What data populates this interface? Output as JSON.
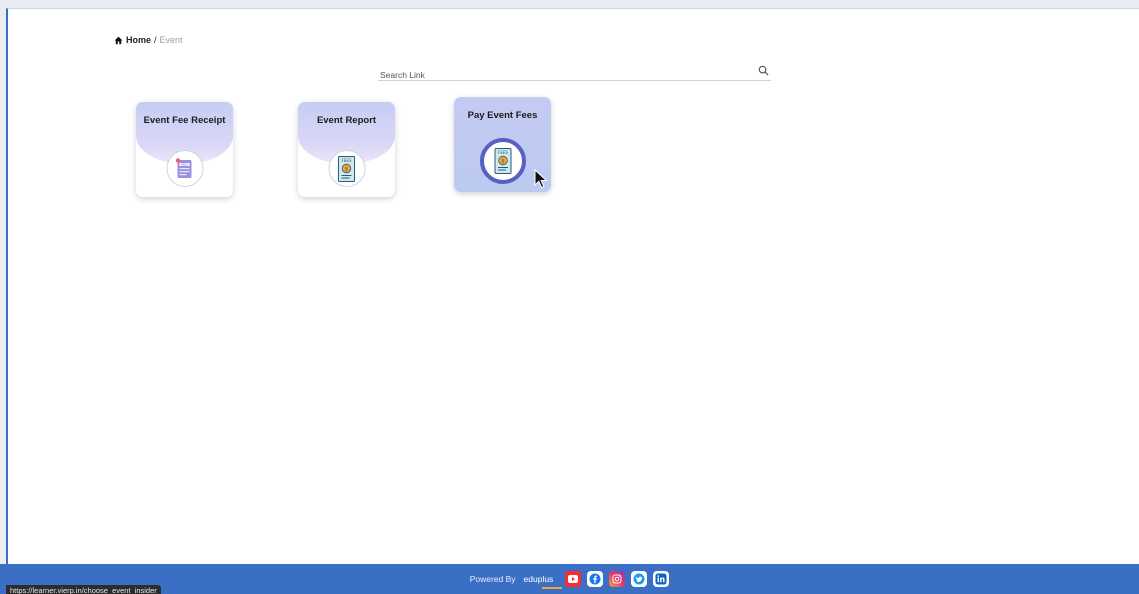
{
  "breadcrumb": {
    "home": "Home",
    "separator": "/",
    "current": "Event"
  },
  "search": {
    "placeholder": "Search Link",
    "value": ""
  },
  "cards": [
    {
      "title": "Event Fee Receipt",
      "icon": "fees-receipt-icon"
    },
    {
      "title": "Event Report",
      "icon": "fees-report-icon"
    },
    {
      "title": "Pay Event Fees",
      "icon": "pay-fees-icon",
      "active": true
    }
  ],
  "footer": {
    "powered_by": "Powered By",
    "brand": "eduplus",
    "social": [
      "youtube-icon",
      "facebook-icon",
      "instagram-icon",
      "twitter-icon",
      "linkedin-icon"
    ]
  },
  "status_bar": {
    "url": "https://learner.vierp.in/choose_event_insider"
  },
  "colors": {
    "accent": "#3b6fc6",
    "card_gradient": "#c6ccf4",
    "active_ring": "#5a5fc2"
  }
}
